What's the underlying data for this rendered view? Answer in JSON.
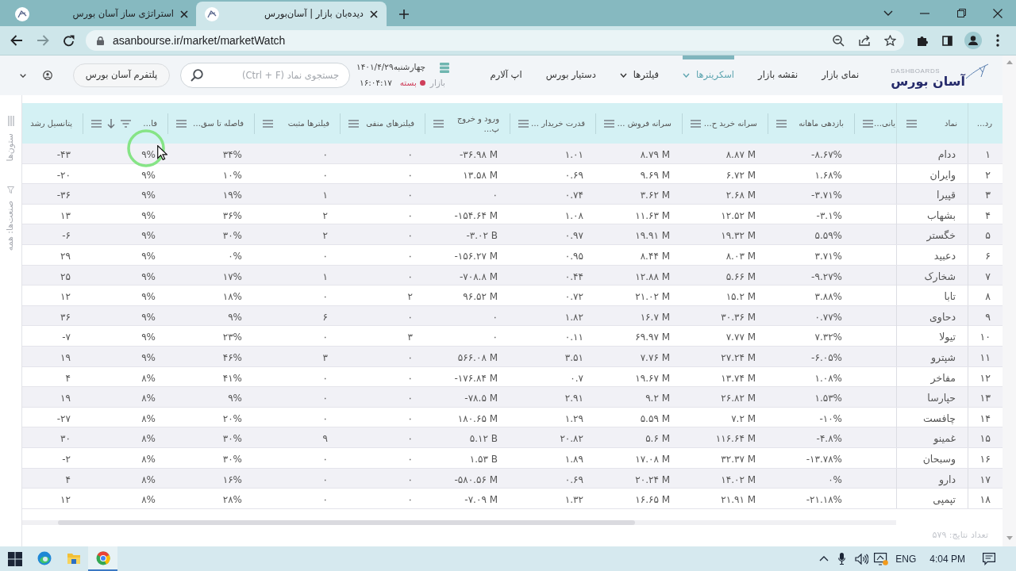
{
  "browser": {
    "tabs": [
      {
        "title": "دیده‌بان بازار | آسان‌بورس",
        "selected": true
      },
      {
        "title": "استراتژی ساز آسان بورس",
        "selected": false
      }
    ],
    "url": "asanbourse.ir/market/marketWatch"
  },
  "header": {
    "logo": {
      "caption": "DASHBOARDS",
      "wordmark": "آسان بورس"
    },
    "nav": [
      {
        "label": "نمای بازار",
        "selected": false,
        "dropdown": false
      },
      {
        "label": "نقشه بازار",
        "selected": false,
        "dropdown": false
      },
      {
        "label": "اسکرینرها",
        "selected": true,
        "dropdown": true
      },
      {
        "label": "فیلترها",
        "selected": false,
        "dropdown": true
      },
      {
        "label": "دستیار بورس",
        "selected": false,
        "dropdown": false
      },
      {
        "label": "اپ آلارم",
        "selected": false,
        "dropdown": false
      }
    ],
    "date": {
      "weekday": "چهارشنبه",
      "date": "۱۴۰۱/۴/۲۹",
      "market_label": "بازار",
      "market_status": "بسته",
      "market_open": false,
      "time": "۱۶:۰۴:۱۷"
    },
    "search": {
      "placeholder": "جستجوی نماد (Ctrl + F)"
    },
    "platform_button": "پلتفرم آسان بورس"
  },
  "sidebar": {
    "items": [
      {
        "kind": "columns",
        "label": "ستون‌ها"
      },
      {
        "kind": "filter",
        "label": "صنعت‌ها: همه"
      }
    ]
  },
  "table": {
    "columns": [
      {
        "label": "رد…",
        "kind": "pinned",
        "has_menu": false,
        "sorted": false,
        "filtered": false
      },
      {
        "label": "نماد",
        "kind": "pinned",
        "has_menu": true,
        "sorted": false,
        "filtered": false
      },
      {
        "label": "یانی…",
        "kind": "partial",
        "has_menu": true,
        "sorted": false,
        "filtered": false
      },
      {
        "label": "بازدهی ماهانه",
        "kind": "data",
        "has_menu": true,
        "sorted": false,
        "filtered": false
      },
      {
        "label": "سرانه خرید ح…",
        "kind": "data",
        "has_menu": true,
        "sorted": false,
        "filtered": false
      },
      {
        "label": "سرانه فروش …",
        "kind": "data",
        "has_menu": true,
        "sorted": false,
        "filtered": false
      },
      {
        "label": "قدرت خریدار …",
        "kind": "data",
        "has_menu": true,
        "sorted": false,
        "filtered": false
      },
      {
        "label": "ورود و خروج پ…",
        "kind": "data",
        "has_menu": true,
        "sorted": false,
        "filtered": false
      },
      {
        "label": "فیلترهای منفی",
        "kind": "data",
        "has_menu": true,
        "sorted": false,
        "filtered": false
      },
      {
        "label": "فیلترها مثبت",
        "kind": "data",
        "has_menu": true,
        "sorted": false,
        "filtered": false
      },
      {
        "label": "فاصله تا سق…",
        "kind": "data",
        "has_menu": true,
        "sorted": false,
        "filtered": false
      },
      {
        "label": "فا…",
        "kind": "data",
        "has_menu": true,
        "sorted": true,
        "filtered": true
      },
      {
        "label": "پتانسیل رشد",
        "kind": "data",
        "has_menu": false,
        "sorted": false,
        "filtered": false
      }
    ],
    "rows": [
      [
        "۱",
        "ددام",
        "",
        "-۸.۶۷%",
        "۸.۸۷ M",
        "۸.۷۹ M",
        "۱.۰۱",
        "-۳۶.۹۸ M",
        "۰",
        "۰",
        "۳۴%",
        "۹%",
        "-۴۳"
      ],
      [
        "۲",
        "وایران",
        "",
        "۱.۶۸%",
        "۶.۷۲ M",
        "۹.۶۹ M",
        "۰.۶۹",
        "۱۳.۵۸ M",
        "۰",
        "۰",
        "۱۰%",
        "۹%",
        "-۲۰"
      ],
      [
        "۳",
        "قپیرا",
        "",
        "-۳.۷۱%",
        "۲.۶۸ M",
        "۳.۶۲ M",
        "۰.۷۴",
        "۰",
        "۰",
        "۱",
        "۱۹%",
        "۹%",
        "-۳۶"
      ],
      [
        "۴",
        "بشهاب",
        "",
        "-۳.۱%",
        "۱۲.۵۲ M",
        "۱۱.۶۳ M",
        "۱.۰۸",
        "-۱۵۴.۶۴ M",
        "۰",
        "۲",
        "۳۶%",
        "۹%",
        "۱۳"
      ],
      [
        "۵",
        "خگستر",
        "",
        "۵.۵۹%",
        "۱۹.۳۲ M",
        "۱۹.۹۱ M",
        "۰.۹۷",
        "-۳.۰۲ B",
        "۰",
        "۲",
        "۳۰%",
        "۹%",
        "-۶"
      ],
      [
        "۶",
        "دعبید",
        "",
        "۳.۷۱%",
        "۸.۰۳ M",
        "۸.۴۴ M",
        "۰.۹۵",
        "-۱۵۶.۲۷ M",
        "۰",
        "۰",
        "۰%",
        "۹%",
        "۲۹"
      ],
      [
        "۷",
        "شخارک",
        "",
        "-۹.۲۷%",
        "۵.۶۶ M",
        "۱۲.۸۸ M",
        "۰.۴۴",
        "-۷۰۸.۸ M",
        "۰",
        "۱",
        "۱۷%",
        "۹%",
        "۲۵"
      ],
      [
        "۸",
        "تابا",
        "",
        "۳.۸۸%",
        "۱۵.۲ M",
        "۲۱.۰۲ M",
        "۰.۷۲",
        "۹۶.۵۲ M",
        "۲",
        "۰",
        "۱۸%",
        "۹%",
        "۱۲"
      ],
      [
        "۹",
        "دحاوی",
        "",
        "۰.۷۷%",
        "۳۰.۳۶ M",
        "۱۶.۷ M",
        "۱.۸۲",
        "۰",
        "۰",
        "۶",
        "۹%",
        "۹%",
        "۳۶"
      ],
      [
        "۱۰",
        "تیولا",
        "",
        "۷.۳۲%",
        "۷.۷۷ M",
        "۶۹.۹۷ M",
        "۰.۱۱",
        "۰",
        "۳",
        "۰",
        "۲۳%",
        "۹%",
        "-۷"
      ],
      [
        "۱۱",
        "شپترو",
        "",
        "-۶.۰۵%",
        "۲۷.۲۴ M",
        "۷.۷۶ M",
        "۳.۵۱",
        "۵۶۶.۰۸ M",
        "۰",
        "۳",
        "۴۶%",
        "۹%",
        "۱۹"
      ],
      [
        "۱۲",
        "مفاخر",
        "",
        "۱.۰۸%",
        "۱۳.۷۴ M",
        "۱۹.۶۷ M",
        "۰.۷",
        "-۱۷۶.۸۴ M",
        "۰",
        "۰",
        "۴۱%",
        "۸%",
        "۴"
      ],
      [
        "۱۳",
        "حپارسا",
        "",
        "۱.۵۳%",
        "۲۶.۸۲ M",
        "۹.۲ M",
        "۲.۹۱",
        "-۷۸.۵ M",
        "۰",
        "۰",
        "۹%",
        "۸%",
        "۱۹"
      ],
      [
        "۱۴",
        "چافست",
        "",
        "-۱۰%",
        "۷.۲ M",
        "۵.۵۹ M",
        "۱.۲۹",
        "۱۸۰.۶۵ M",
        "۰",
        "۰",
        "۲۰%",
        "۸%",
        "-۲۷"
      ],
      [
        "۱۵",
        "غمینو",
        "",
        "-۴.۸%",
        "۱۱۶.۶۴ M",
        "۵.۶ M",
        "۲۰.۸۲",
        "۵.۱۲ B",
        "۰",
        "۹",
        "۳۰%",
        "۸%",
        "۳۰"
      ],
      [
        "۱۶",
        "وسبحان",
        "",
        "-۱۳.۷۸%",
        "۳۲.۳۷ M",
        "۱۷.۰۸ M",
        "۱.۸۹",
        "۱.۵۳ B",
        "۰",
        "۰",
        "۳۰%",
        "۸%",
        "-۲"
      ],
      [
        "۱۷",
        "دارو",
        "",
        "۰%",
        "۱۴.۰۲ M",
        "۲۰.۲۴ M",
        "۰.۶۹",
        "-۵۸۰.۵۶ M",
        "۰",
        "۰",
        "۱۶%",
        "۸%",
        "۴"
      ],
      [
        "۱۸",
        "تپمپی",
        "",
        "-۲۱.۱۸%",
        "۲۱.۹۱ M",
        "۱۶.۶۵ M",
        "۱.۳۲",
        "-۷.۰۹ M",
        "۰",
        "۰",
        "۲۸%",
        "۸%",
        "۱۲"
      ]
    ]
  },
  "footer": {
    "result_count": "تعداد نتایج: ۵۷۹"
  },
  "taskbar": {
    "apps": [
      {
        "kind": "edge",
        "selected": false
      },
      {
        "kind": "explorer",
        "selected": false
      },
      {
        "kind": "chrome",
        "selected": true
      }
    ],
    "language": "ENG",
    "time": "4:04 PM"
  }
}
